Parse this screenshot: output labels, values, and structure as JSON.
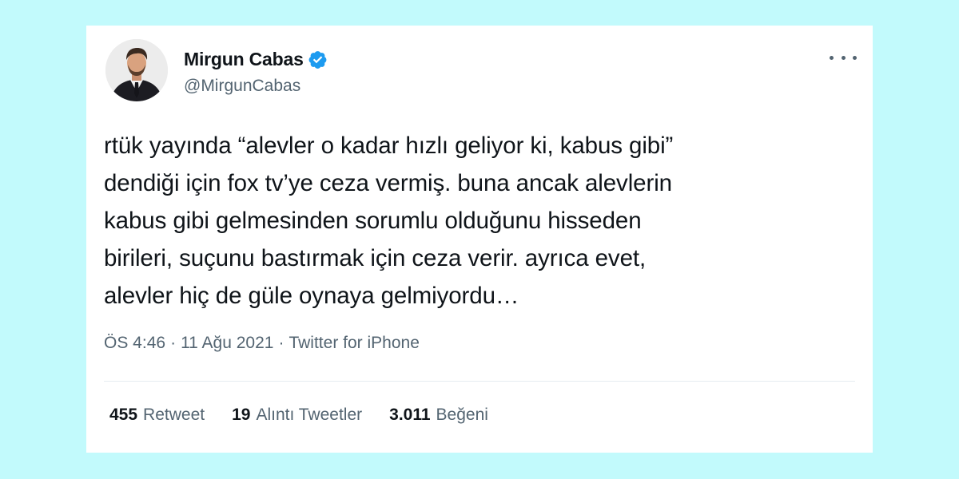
{
  "tweet": {
    "author": {
      "name": "Mirgun Cabas",
      "handle": "@MirgunCabas",
      "verified": true,
      "avatar_icon": "profile-photo"
    },
    "text": "rtük yayında “alevler o kadar hızlı geliyor ki, kabus gibi”\ndendiği için fox tv’ye ceza vermiş. buna ancak alevlerin\nkabus gibi gelmesinden sorumlu olduğunu hisseden\nbirileri, suçunu bastırmak için  ceza verir. ayrıca evet,\nalevler hiç de güle oynaya gelmiyordu…",
    "meta": {
      "time": "ÖS 4:46",
      "separator": "·",
      "date": "11 Ağu 2021",
      "source": "Twitter for iPhone"
    },
    "stats": {
      "retweets": {
        "count": "455",
        "label": "Retweet"
      },
      "quotes": {
        "count": "19",
        "label": "Alıntı Tweetler"
      },
      "likes": {
        "count": "3.011",
        "label": "Beğeni"
      }
    },
    "menu_icon": "more-dots-icon"
  },
  "colors": {
    "background": "#c2fafc",
    "card": "#ffffff",
    "text_primary": "#0f1419",
    "text_secondary": "#536471",
    "verified_badge": "#1d9bf0"
  }
}
